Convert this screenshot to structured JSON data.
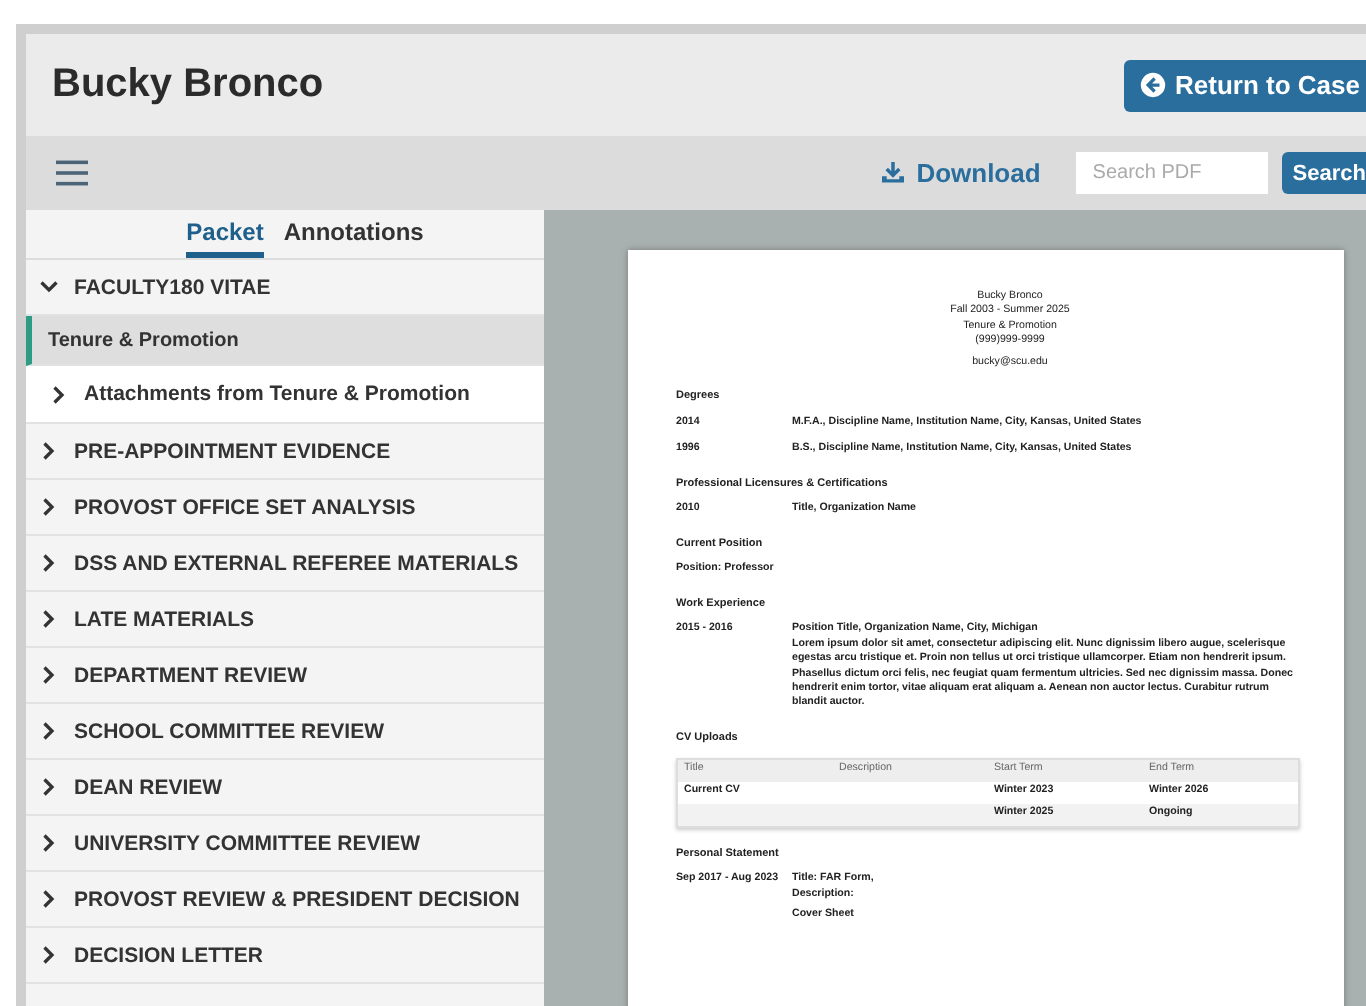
{
  "header": {
    "title": "Bucky Bronco",
    "return_button": "Return to Case"
  },
  "toolbar": {
    "download": "Download",
    "search": {
      "placeholder": "Search PDF"
    },
    "search_button": "Search"
  },
  "tabs": [
    {
      "label": "Packet",
      "selected": true
    },
    {
      "label": "Annotations",
      "selected": false
    }
  ],
  "sidebar": {
    "items": [
      {
        "kind": "folder",
        "label": "FACULTY180 VITAE",
        "expanded": true,
        "children": [
          {
            "kind": "heading",
            "label": "Tenure & Promotion",
            "selected": true,
            "children": [
              {
                "kind": "file",
                "label": "Attachments from Tenure & Promotion",
                "expanded": false
              }
            ]
          }
        ]
      },
      {
        "kind": "folder",
        "label": "PRE-APPOINTMENT EVIDENCE",
        "expanded": false
      },
      {
        "kind": "folder",
        "label": "PROVOST OFFICE SET ANALYSIS",
        "expanded": false
      },
      {
        "kind": "folder",
        "label": "DSS AND EXTERNAL REFEREE MATERIALS",
        "expanded": false
      },
      {
        "kind": "folder",
        "label": "LATE MATERIALS",
        "expanded": false
      },
      {
        "kind": "folder",
        "label": "DEPARTMENT REVIEW",
        "expanded": false
      },
      {
        "kind": "folder",
        "label": "SCHOOL COMMITTEE REVIEW",
        "expanded": false
      },
      {
        "kind": "folder",
        "label": "DEAN REVIEW",
        "expanded": false
      },
      {
        "kind": "folder",
        "label": "UNIVERSITY COMMITTEE REVIEW",
        "expanded": false
      },
      {
        "kind": "folder",
        "label": "PROVOST REVIEW & PRESIDENT DECISION",
        "expanded": false
      },
      {
        "kind": "folder",
        "label": "DECISION LETTER",
        "expanded": false
      }
    ]
  },
  "document": {
    "header_lines": [
      "Bucky Bronco",
      "Fall 2003 - Summer 2025",
      "Tenure & Promotion",
      "(999)999-9999"
    ],
    "email": "bucky@scu.edu",
    "sections": [
      {
        "kind": "rows",
        "heading": "Degrees",
        "rows": [
          {
            "date": "2014",
            "lines": [
              "M.F.A., Discipline Name, Institution Name, City, Kansas, United States"
            ]
          },
          {
            "date": "1996",
            "lines": [
              "B.S., Discipline Name, Institution Name, City, Kansas, United States"
            ]
          }
        ]
      },
      {
        "kind": "rows",
        "heading": "Professional Licensures & Certifications",
        "rows": [
          {
            "date": "2010",
            "lines": [
              "Title, Organization Name"
            ]
          }
        ]
      },
      {
        "kind": "note",
        "heading": "Current Position",
        "text": "Position: Professor"
      },
      {
        "kind": "rows",
        "heading": "Work Experience",
        "rows": [
          {
            "date": "2015 - 2016",
            "lines": [
              "Position Title, Organization Name, City, Michigan",
              "Lorem ipsum dolor sit amet, consectetur adipiscing elit. Nunc dignissim libero augue, scelerisque egestas arcu tristique et. Proin non tellus ut orci tristique ullamcorper. Etiam non hendrerit ipsum. Phasellus dictum orci felis, nec feugiat quam fermentum ultricies. Sed nec dignissim massa. Donec hendrerit enim tortor, vitae aliquam erat aliquam a. Aenean non auctor lectus. Curabitur rutrum blandit auctor."
            ]
          }
        ]
      },
      {
        "kind": "table",
        "heading": "CV Uploads",
        "columns": [
          "Title",
          "Description",
          "Start Term",
          "End Term"
        ],
        "rows": [
          [
            "Current CV",
            "",
            "Winter 2023",
            "Winter 2026"
          ],
          [
            "",
            "",
            "Winter 2025",
            "Ongoing"
          ]
        ]
      },
      {
        "kind": "rows",
        "heading": "Personal Statement",
        "rows": [
          {
            "date": "Sep 2017 - Aug 2023",
            "lines": [
              "Title: FAR Form,",
              "Description:",
              "Cover Sheet"
            ]
          }
        ]
      }
    ]
  }
}
